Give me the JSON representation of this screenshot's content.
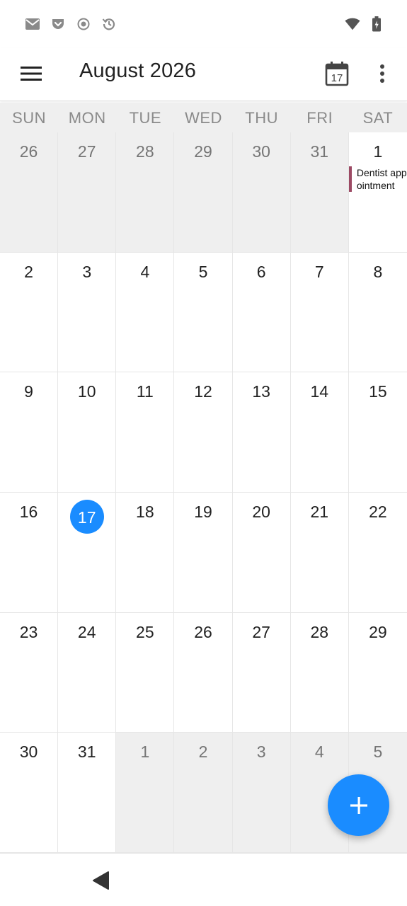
{
  "status_bar": {
    "left_icons": [
      "gmail-icon",
      "pocket-icon",
      "record-icon",
      "history-icon"
    ],
    "right_icons": [
      "wifi-icon",
      "battery-charging-icon"
    ]
  },
  "app_bar": {
    "title": "August 2026",
    "today_button_day": "17",
    "icons": [
      "menu-icon",
      "today-calendar-icon",
      "more-vert-icon"
    ]
  },
  "weekdays": [
    "SUN",
    "MON",
    "TUE",
    "WED",
    "THU",
    "FRI",
    "SAT"
  ],
  "weeks": [
    [
      {
        "d": "26",
        "other": true
      },
      {
        "d": "27",
        "other": true
      },
      {
        "d": "28",
        "other": true
      },
      {
        "d": "29",
        "other": true
      },
      {
        "d": "30",
        "other": true
      },
      {
        "d": "31",
        "other": true
      },
      {
        "d": "1",
        "event": "Dentist appointment"
      }
    ],
    [
      {
        "d": "2"
      },
      {
        "d": "3"
      },
      {
        "d": "4"
      },
      {
        "d": "5"
      },
      {
        "d": "6"
      },
      {
        "d": "7"
      },
      {
        "d": "8"
      }
    ],
    [
      {
        "d": "9"
      },
      {
        "d": "10"
      },
      {
        "d": "11"
      },
      {
        "d": "12"
      },
      {
        "d": "13"
      },
      {
        "d": "14"
      },
      {
        "d": "15"
      }
    ],
    [
      {
        "d": "16"
      },
      {
        "d": "17",
        "today": true
      },
      {
        "d": "18"
      },
      {
        "d": "19"
      },
      {
        "d": "20"
      },
      {
        "d": "21"
      },
      {
        "d": "22"
      }
    ],
    [
      {
        "d": "23"
      },
      {
        "d": "24"
      },
      {
        "d": "25"
      },
      {
        "d": "26"
      },
      {
        "d": "27"
      },
      {
        "d": "28"
      },
      {
        "d": "29"
      }
    ],
    [
      {
        "d": "30"
      },
      {
        "d": "31"
      },
      {
        "d": "1",
        "other": true
      },
      {
        "d": "2",
        "other": true
      },
      {
        "d": "3",
        "other": true
      },
      {
        "d": "4",
        "other": true
      },
      {
        "d": "5",
        "other": true
      }
    ]
  ],
  "colors": {
    "accent": "#1a8cff",
    "event_bar": "#9c4a64",
    "other_month_bg": "#efefef"
  },
  "fab": {
    "icon": "add-icon"
  },
  "nav_bar": {
    "icons": [
      "back-icon"
    ]
  }
}
